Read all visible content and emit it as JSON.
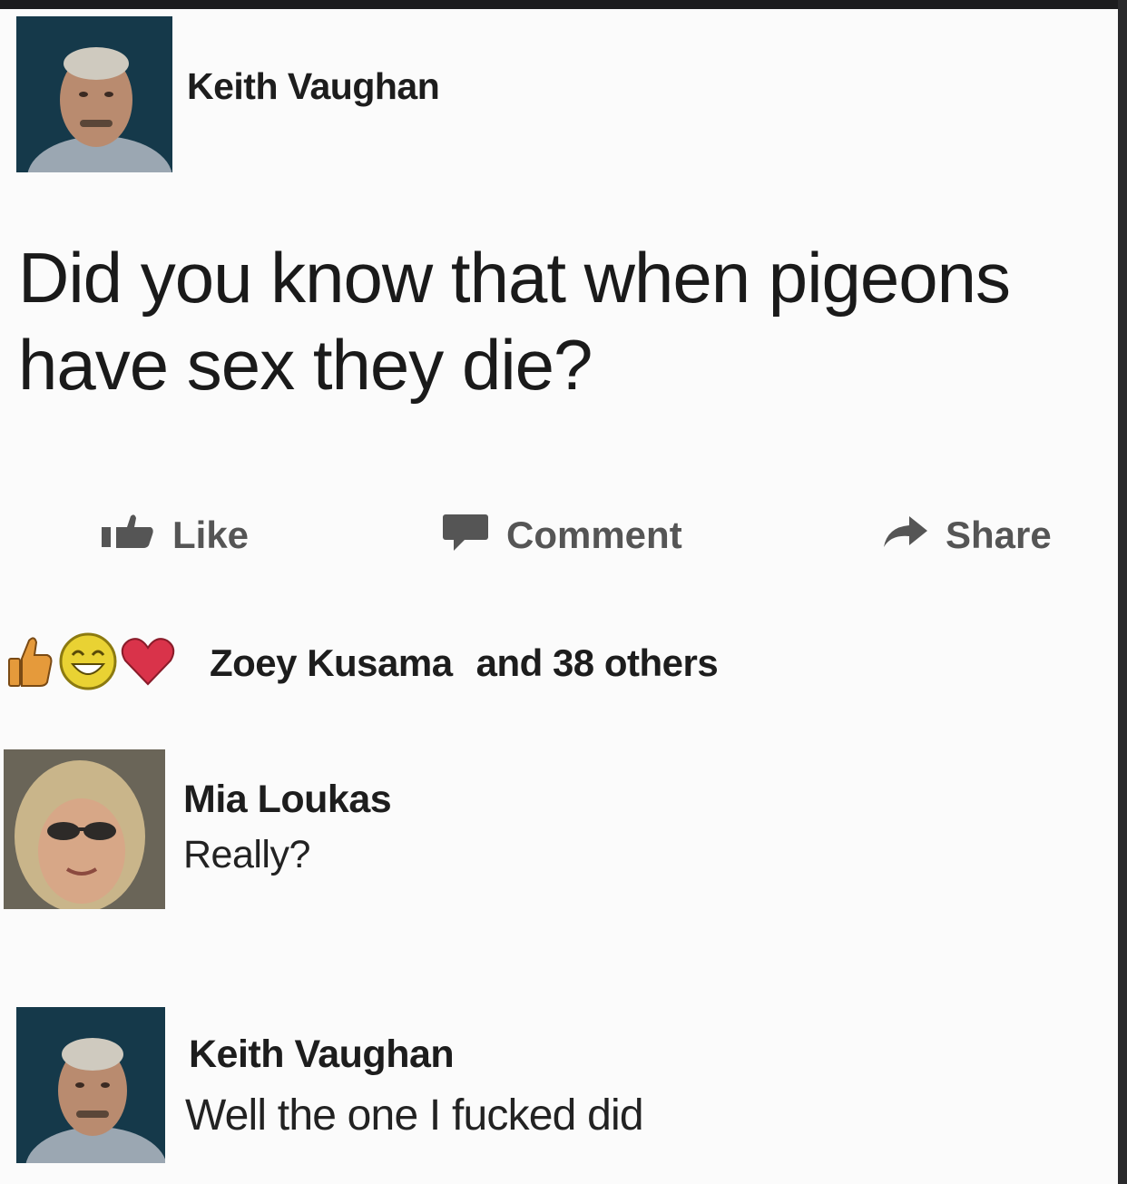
{
  "post": {
    "author": "Keith Vaughan",
    "text": "Did you know that when pigeons have sex they die?"
  },
  "actions": {
    "like_label": "Like",
    "comment_label": "Comment",
    "share_label": "Share"
  },
  "reactions": {
    "icons": [
      "thumbs-up-icon",
      "laughing-face-icon",
      "heart-icon"
    ],
    "name": "Zoey Kusama",
    "others_text": "and 38 others"
  },
  "comments": [
    {
      "author": "Mia Loukas",
      "text": "Really?"
    },
    {
      "author": "Keith Vaughan",
      "text": "Well the one I fucked did"
    }
  ],
  "colors": {
    "background": "#fbfbfb",
    "action_gray": "#555555",
    "heart_red": "#d9334a",
    "thumb_orange": "#e59a3b",
    "smiley_yellow": "#e9d233"
  }
}
